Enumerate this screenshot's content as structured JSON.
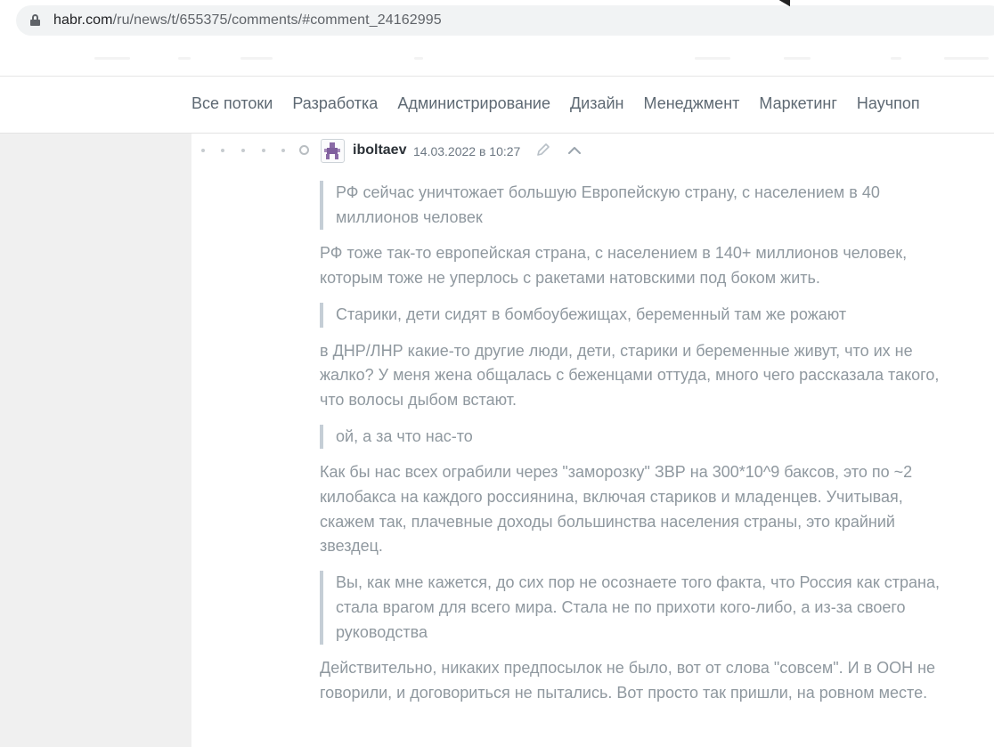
{
  "browser": {
    "url_host": "habr.com",
    "url_path": "/ru/news/t/655375/comments/#comment_24162995"
  },
  "nav": {
    "items": [
      "Все потоки",
      "Разработка",
      "Администрирование",
      "Дизайн",
      "Менеджмент",
      "Маркетинг",
      "Научпоп"
    ]
  },
  "comment": {
    "author": "iboltaev",
    "timestamp": "14.03.2022 в 10:27",
    "blocks": [
      {
        "type": "quote",
        "text": "РФ сейчас уничтожает большую Европейскую страну, с населением в 40 миллионов человек"
      },
      {
        "type": "text",
        "text": "РФ тоже так-то европейская страна, с населением в 140+ миллионов человек, которым тоже не уперлось с ракетами натовскими под боком жить."
      },
      {
        "type": "quote",
        "text": "Старики, дети сидят в бомбоубежищах, беременный там же рожают"
      },
      {
        "type": "text",
        "text": "в ДНР/ЛНР какие-то другие люди, дети, старики и беременные живут, что их не жалко? У меня жена общалась с беженцами оттуда, много чего рассказала такого, что волосы дыбом встают."
      },
      {
        "type": "quote",
        "text": "ой, а за что нас-то"
      },
      {
        "type": "text",
        "text": "Как бы нас всех ограбили через \"заморозку\" ЗВР на 300*10^9 баксов, это по ~2 килобакса на каждого россиянина, включая стариков и младенцев. Учитывая, скажем так, плачевные доходы большинства населения страны, это крайний звездец."
      },
      {
        "type": "quote",
        "text": "Вы, как мне кажется, до сих пор не осознаете того факта, что Россия как страна, стала врагом для всего мира. Стала не по прихоти кого-либо, а из-за своего руководства"
      },
      {
        "type": "text",
        "text": "Действительно, никаких предпосылок не было, вот от слова \"совсем\". И в ООН не говорили, и договориться не пытались. Вот просто так пришли, на ровном месте."
      }
    ]
  },
  "icons": {
    "lock": "lock-icon",
    "avatar": "avatar",
    "edit": "pencil-icon",
    "collapse": "chevron-up-icon",
    "cursor": "mouse-cursor-icon"
  },
  "colors": {
    "accent_blue": "#548eaa",
    "text_muted": "#8f989f",
    "nav_text": "#5e6973"
  }
}
